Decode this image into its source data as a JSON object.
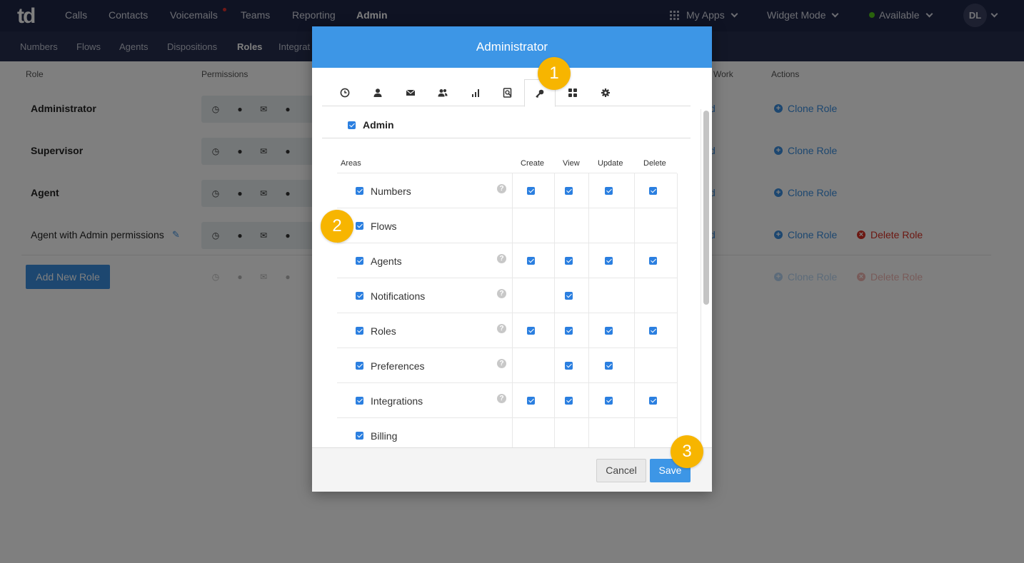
{
  "app": {
    "logo": "td",
    "nav": [
      "Calls",
      "Contacts",
      "Voicemails",
      "Teams",
      "Reporting",
      "Admin"
    ],
    "my_apps": "My Apps",
    "widget_mode": "Widget Mode",
    "status": "Available",
    "avatar": "DL"
  },
  "subnav": [
    "Numbers",
    "Flows",
    "Agents",
    "Dispositions",
    "Roles",
    "Integrat"
  ],
  "roles_page": {
    "col_role": "Role",
    "col_permissions": "Permissions",
    "col_work": "Work",
    "col_actions": "Actions",
    "roles": [
      "Administrator",
      "Supervisor",
      "Agent",
      "Agent with Admin permissions"
    ],
    "work_fragment": "d",
    "clone_role": "Clone Role",
    "delete_role": "Delete Role",
    "add_new_role": "Add New Role"
  },
  "modal": {
    "title": "Administrator",
    "tab_icons": [
      "clock-icon",
      "user-icon",
      "mail-icon",
      "team-icon",
      "bar-chart-icon",
      "search-doc-icon",
      "key-icon",
      "apps-icon",
      "gear-icon"
    ],
    "section": "Admin",
    "headers": {
      "areas": "Areas",
      "create": "Create",
      "view": "View",
      "update": "Update",
      "delete": "Delete"
    },
    "rows": [
      {
        "area": "Numbers",
        "help": true,
        "create": true,
        "view": true,
        "update": true,
        "delete": true
      },
      {
        "area": "Flows",
        "help": false,
        "create": false,
        "view": false,
        "update": false,
        "delete": false
      },
      {
        "area": "Agents",
        "help": true,
        "create": true,
        "view": true,
        "update": true,
        "delete": true
      },
      {
        "area": "Notifications",
        "help": true,
        "create": false,
        "view": true,
        "update": false,
        "delete": false
      },
      {
        "area": "Roles",
        "help": true,
        "create": true,
        "view": true,
        "update": true,
        "delete": true
      },
      {
        "area": "Preferences",
        "help": true,
        "create": false,
        "view": true,
        "update": true,
        "delete": false
      },
      {
        "area": "Integrations",
        "help": true,
        "create": true,
        "view": true,
        "update": true,
        "delete": true
      },
      {
        "area": "Billing",
        "help": false,
        "create": false,
        "view": false,
        "update": false,
        "delete": false
      }
    ],
    "cancel": "Cancel",
    "save": "Save"
  },
  "annotations": [
    "1",
    "2",
    "3"
  ],
  "colors": {
    "nav_bg": "#1f2747",
    "subnav_bg": "#262e4e",
    "accent": "#3d96e6",
    "badge": "#f7b500",
    "delete": "#d93025"
  }
}
